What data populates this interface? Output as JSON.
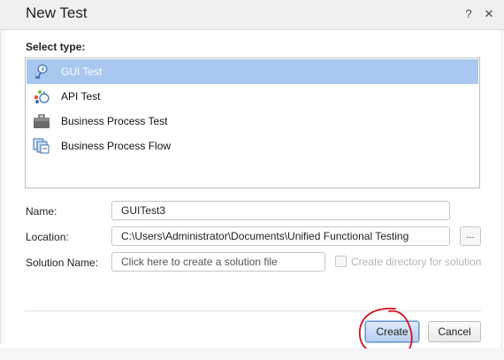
{
  "window": {
    "title": "New Test",
    "help_glyph": "?",
    "close_glyph": "✕"
  },
  "select_type": {
    "label": "Select type:",
    "items": [
      {
        "label": "GUI Test",
        "icon": "gui-test-icon",
        "selected": true
      },
      {
        "label": "API Test",
        "icon": "api-test-icon",
        "selected": false
      },
      {
        "label": "Business Process Test",
        "icon": "briefcase-icon",
        "selected": false
      },
      {
        "label": "Business Process Flow",
        "icon": "process-flow-icon",
        "selected": false
      }
    ]
  },
  "form": {
    "name_label": "Name:",
    "name_value": "GUITest3",
    "location_label": "Location:",
    "location_value": "C:\\Users\\Administrator\\Documents\\Unified Functional Testing",
    "browse_label": "...",
    "solution_label": "Solution Name:",
    "solution_placeholder": "Click here to create a solution file",
    "create_dir_label": "Create directory for solution",
    "create_dir_checked": false
  },
  "buttons": {
    "create": "Create",
    "cancel": "Cancel"
  },
  "colors": {
    "selection": "#a8c8f0",
    "annotation": "#d4101b",
    "primary_button": "#b5cff0"
  }
}
